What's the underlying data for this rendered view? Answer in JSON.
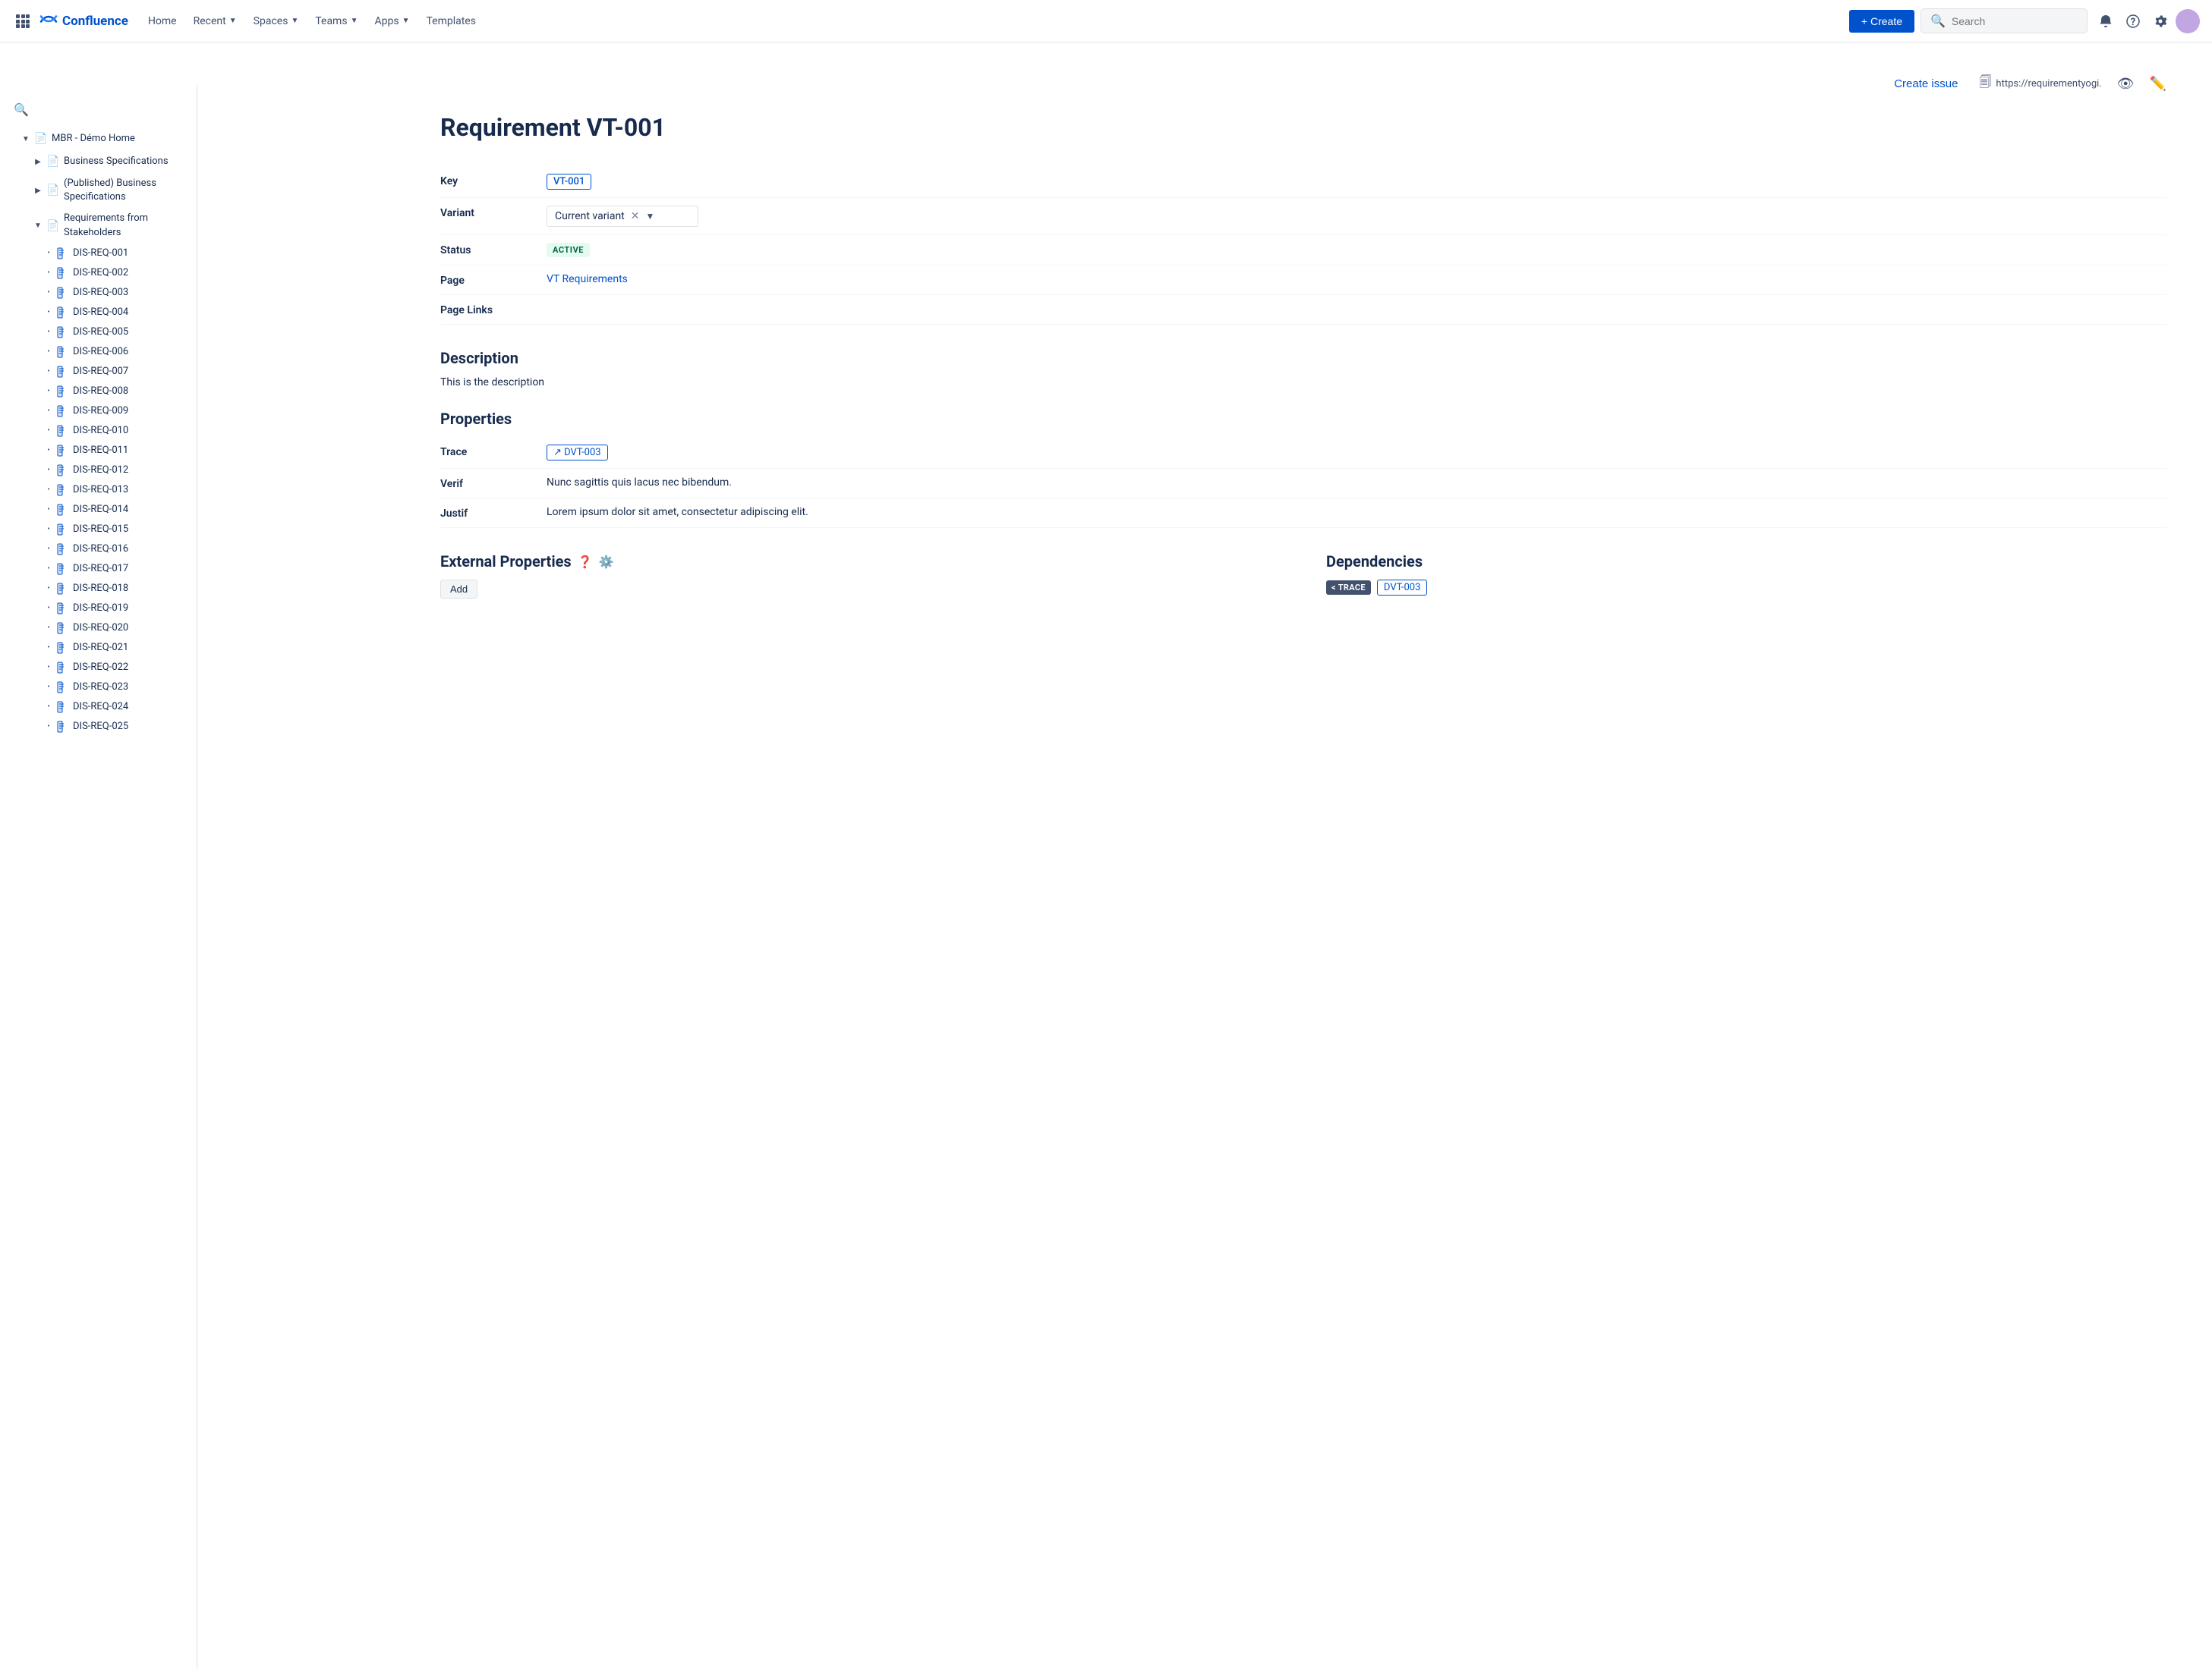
{
  "topnav": {
    "logo_text": "Confluence",
    "home_label": "Home",
    "recent_label": "Recent",
    "spaces_label": "Spaces",
    "teams_label": "Teams",
    "apps_label": "Apps",
    "templates_label": "Templates",
    "create_label": "+ Create",
    "search_placeholder": "Search"
  },
  "sidebar": {
    "collapse_icon": "❯",
    "search_icon": "🔍",
    "tree": [
      {
        "id": "mbr-demo",
        "label": "MBR - Démo Home",
        "indent": 0,
        "type": "parent",
        "expanded": true,
        "icon": "📄"
      },
      {
        "id": "business-specs",
        "label": "Business Specifications",
        "indent": 1,
        "type": "parent",
        "expanded": false,
        "icon": "📄"
      },
      {
        "id": "published-business-specs",
        "label": "(Published) Business Specifications",
        "indent": 1,
        "type": "parent",
        "expanded": false,
        "icon": "📄"
      },
      {
        "id": "reqs-from-stakeholders",
        "label": "Requirements from Stakeholders",
        "indent": 1,
        "type": "parent",
        "expanded": true,
        "icon": "📄"
      }
    ],
    "leaves": [
      "DIS-REQ-001",
      "DIS-REQ-002",
      "DIS-REQ-003",
      "DIS-REQ-004",
      "DIS-REQ-005",
      "DIS-REQ-006",
      "DIS-REQ-007",
      "DIS-REQ-008",
      "DIS-REQ-009",
      "DIS-REQ-010",
      "DIS-REQ-011",
      "DIS-REQ-012",
      "DIS-REQ-013",
      "DIS-REQ-014",
      "DIS-REQ-015",
      "DIS-REQ-016",
      "DIS-REQ-017",
      "DIS-REQ-018",
      "DIS-REQ-019",
      "DIS-REQ-020",
      "DIS-REQ-021",
      "DIS-REQ-022",
      "DIS-REQ-023",
      "DIS-REQ-024",
      "DIS-REQ-025"
    ]
  },
  "page": {
    "title": "Requirement VT-001",
    "key": "VT-001",
    "variant_label": "Current variant",
    "status": "ACTIVE",
    "page_link_label": "VT Requirements",
    "page_links_label": "Page Links",
    "create_issue_label": "Create issue",
    "url_text": "https://requirementyogi.",
    "description_title": "Description",
    "description_text": "This is the description",
    "properties_title": "Properties",
    "trace_id": "↗ DVT-003",
    "verif_text": "Nunc sagittis quis lacus nec bibendum.",
    "justif_text": "Lorem ipsum dolor sit amet, consectetur adipiscing elit.",
    "ext_props_title": "External Properties",
    "deps_title": "Dependencies",
    "add_label": "Add",
    "dep_trace_label": "< TRACE",
    "dep_id": "DVT-003",
    "fields": {
      "key_label": "Key",
      "variant_label": "Variant",
      "status_label": "Status",
      "page_label": "Page",
      "page_links_label": "Page Links",
      "trace_label": "Trace",
      "verif_label": "Verif",
      "justif_label": "Justif"
    }
  }
}
